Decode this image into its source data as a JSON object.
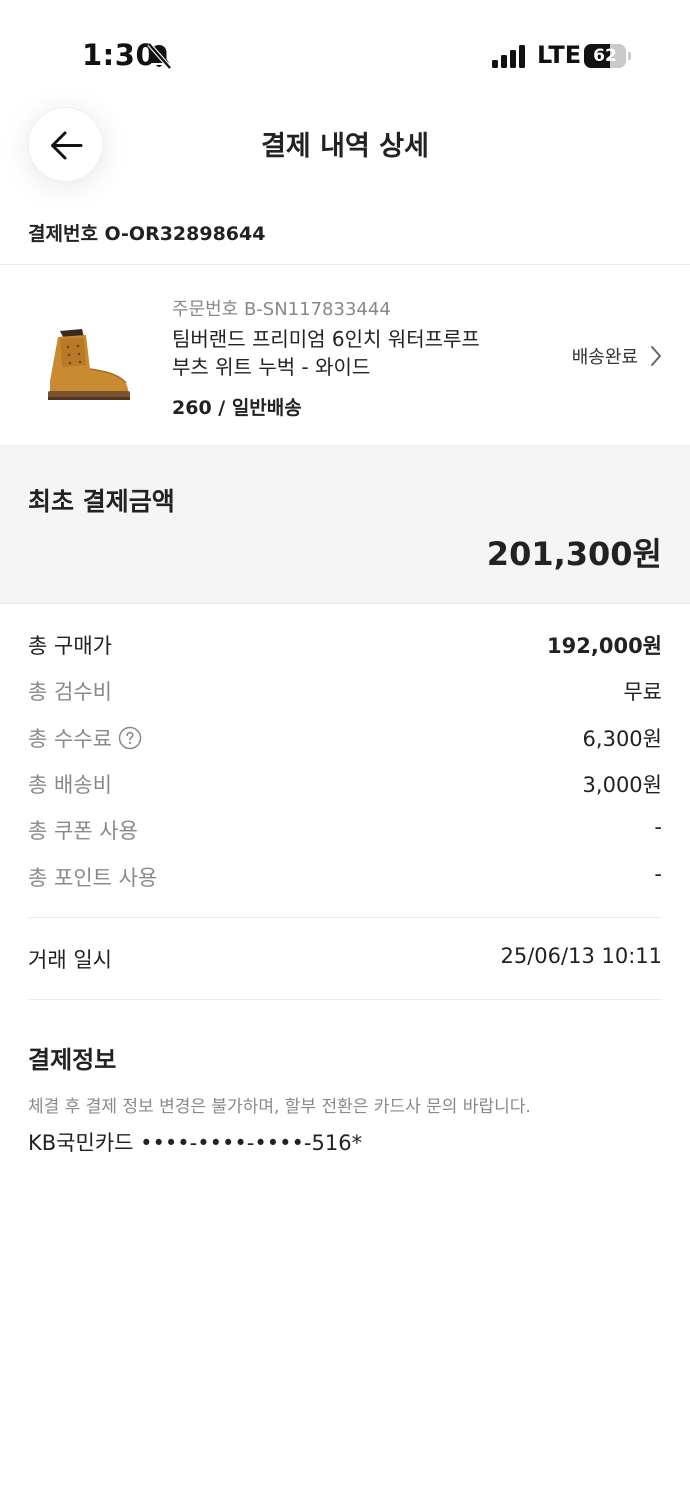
{
  "status_bar": {
    "time": "1:30",
    "network": "LTE",
    "battery": "62",
    "battery_level": 0.62
  },
  "header": {
    "title": "결제 내역 상세",
    "back_icon": "arrow-left-icon"
  },
  "payment_number": "결제번호 O-OR32898644",
  "product": {
    "order_number": "주문번호 B-SN117833444",
    "name_line1": "팀버랜드 프리미엄 6인치 워터프루프",
    "name_line2": "부츠 위트 누벅 - 와이드",
    "option": "260 / 일반배송",
    "status": "배송완료",
    "status_icon": "chevron-right-icon"
  },
  "initial_payment": {
    "label": "최초 결제금액",
    "amount": "201,300원"
  },
  "breakdown": [
    {
      "label": "총 구매가",
      "value": "192,000원"
    },
    {
      "label": "총 검수비",
      "value": "무료"
    },
    {
      "label": "총 수수료",
      "value": "6,300원",
      "icon": "question-circle-icon"
    },
    {
      "label": "총 배송비",
      "value": "3,000원"
    },
    {
      "label": "총 쿠폰 사용",
      "value": "-"
    },
    {
      "label": "총 포인트 사용",
      "value": "-"
    }
  ],
  "transaction": {
    "label": "거래 일시",
    "value": "25/06/13 10:11"
  },
  "payment_info": {
    "title": "결제정보",
    "notice": "체결 후 결제 정보 변경은 불가하며, 할부 전환은 카드사 문의 바랍니다.",
    "card": "KB국민카드 ••••-••••-••••-516*"
  },
  "colors": {
    "text_primary": "#222222",
    "text_secondary": "#8a8a8a",
    "box_background": "#f5f5f5",
    "divider": "#ececec"
  }
}
